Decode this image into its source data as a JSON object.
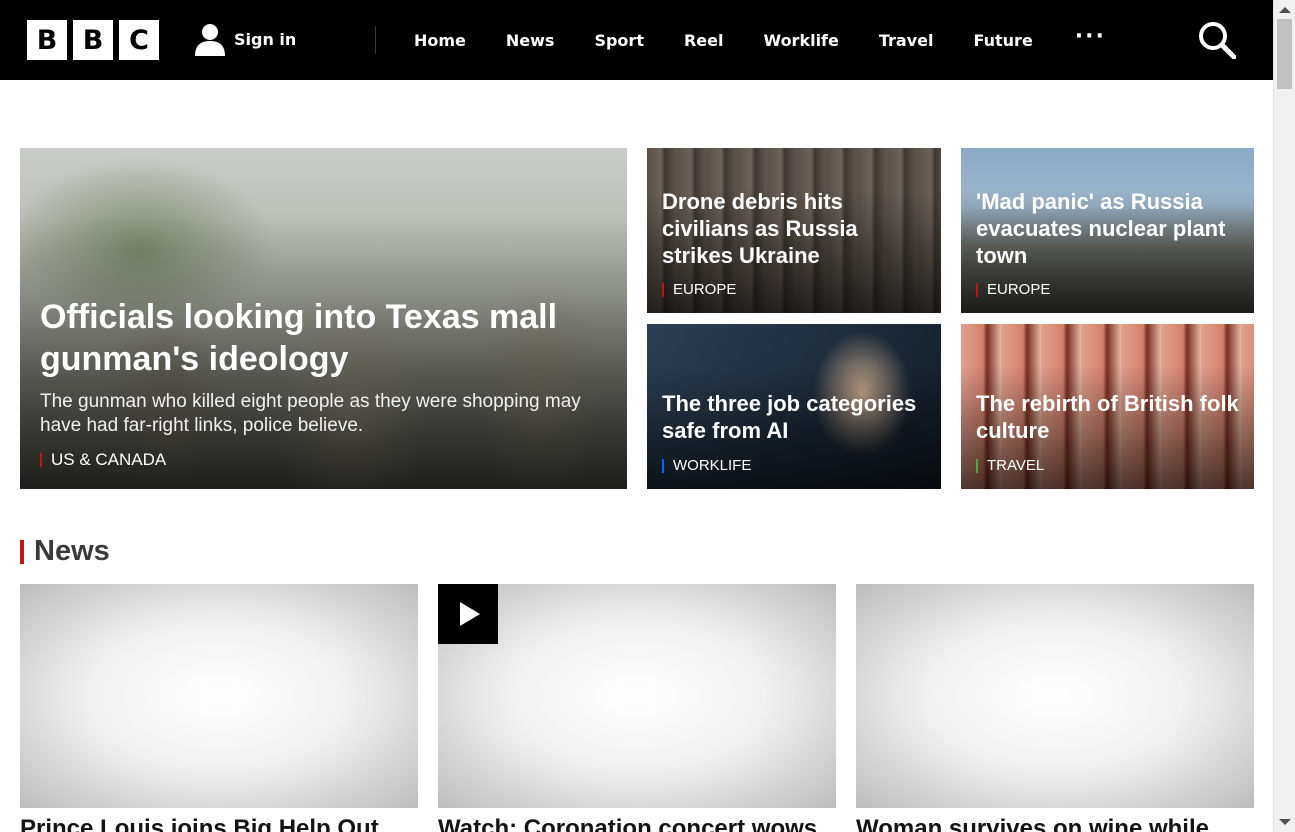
{
  "header": {
    "logo_letters": [
      "B",
      "B",
      "C"
    ],
    "signin_label": "Sign in",
    "nav": [
      "Home",
      "News",
      "Sport",
      "Reel",
      "Worklife",
      "Travel",
      "Future"
    ],
    "more_label": "···"
  },
  "promos": {
    "main": {
      "title": "Officials looking into Texas mall gunman's ideology",
      "summary": "The gunman who killed eight people as they were shopping may have had far-right links, police believe.",
      "tag": "US & CANADA",
      "tag_color": "#bb1919"
    },
    "cards": [
      {
        "title": "Drone debris hits civilians as Russia strikes Ukraine",
        "tag": "EUROPE",
        "tag_color": "#bb1919"
      },
      {
        "title": "'Mad panic' as Russia evacuates nuclear plant town",
        "tag": "EUROPE",
        "tag_color": "#bb1919"
      },
      {
        "title": "The three job categories safe from AI",
        "tag": "WORKLIFE",
        "tag_color": "#0068ff"
      },
      {
        "title": "The rebirth of British folk culture",
        "tag": "TRAVEL",
        "tag_color": "#589e50"
      }
    ]
  },
  "news": {
    "section_title": "News",
    "accent_color": "#bb1919",
    "items": [
      {
        "headline": "Prince Louis joins Big Help Out",
        "has_video": false
      },
      {
        "headline": "Watch: Coronation concert wows",
        "has_video": true
      },
      {
        "headline": "Woman survives on wine while",
        "has_video": false
      }
    ]
  }
}
